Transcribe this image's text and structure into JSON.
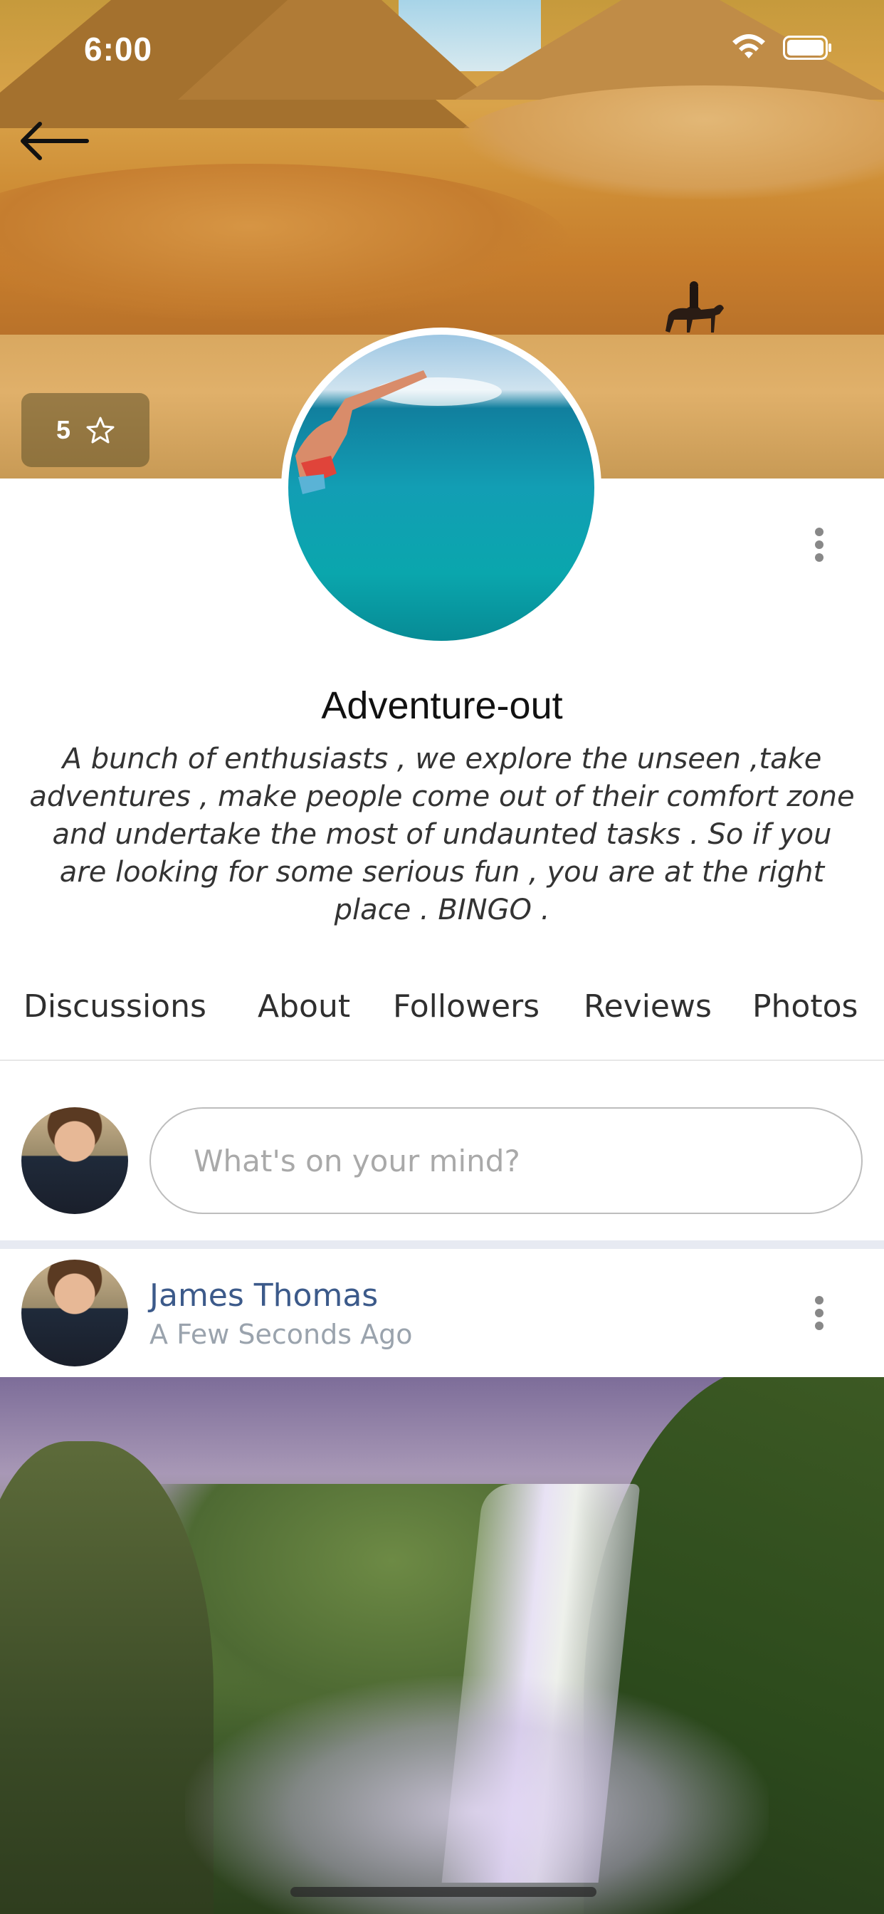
{
  "status_bar": {
    "time": "6:00"
  },
  "header": {
    "rating": "5",
    "rating_icon": "star-icon",
    "back_icon": "arrow-left-icon"
  },
  "group": {
    "name": "Adventure-out",
    "description": "A bunch of enthusiasts , we explore the unseen ,take adventures , make people come out of their comfort zone and undertake the most of undaunted tasks . So if you are looking for some serious fun , you are at the right place . BINGO ."
  },
  "tabs": [
    {
      "label": "Discussions"
    },
    {
      "label": "About"
    },
    {
      "label": "Followers"
    },
    {
      "label": "Reviews"
    },
    {
      "label": "Photos"
    }
  ],
  "composer": {
    "placeholder": "What's on your mind?"
  },
  "post": {
    "author": "James Thomas",
    "time": "A Few Seconds Ago"
  },
  "colors": {
    "author_link": "#3c5a8a",
    "separator": "#e7eaf2"
  }
}
